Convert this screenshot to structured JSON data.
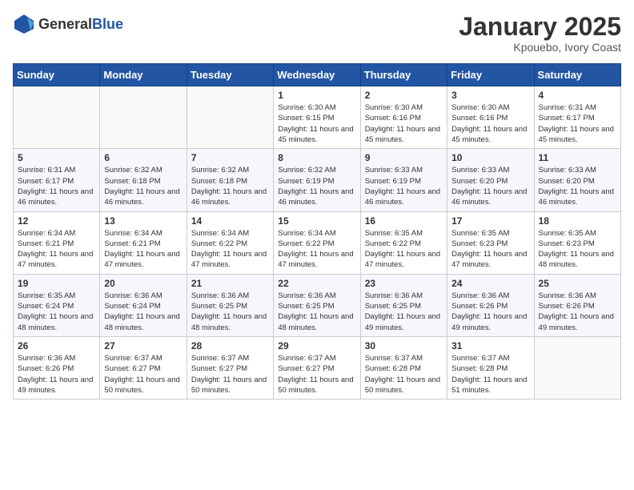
{
  "logo": {
    "general": "General",
    "blue": "Blue"
  },
  "header": {
    "month": "January 2025",
    "location": "Kpouebo, Ivory Coast"
  },
  "weekdays": [
    "Sunday",
    "Monday",
    "Tuesday",
    "Wednesday",
    "Thursday",
    "Friday",
    "Saturday"
  ],
  "weeks": [
    [
      {
        "day": "",
        "sunrise": "",
        "sunset": "",
        "daylight": ""
      },
      {
        "day": "",
        "sunrise": "",
        "sunset": "",
        "daylight": ""
      },
      {
        "day": "",
        "sunrise": "",
        "sunset": "",
        "daylight": ""
      },
      {
        "day": "1",
        "sunrise": "Sunrise: 6:30 AM",
        "sunset": "Sunset: 6:15 PM",
        "daylight": "Daylight: 11 hours and 45 minutes."
      },
      {
        "day": "2",
        "sunrise": "Sunrise: 6:30 AM",
        "sunset": "Sunset: 6:16 PM",
        "daylight": "Daylight: 11 hours and 45 minutes."
      },
      {
        "day": "3",
        "sunrise": "Sunrise: 6:30 AM",
        "sunset": "Sunset: 6:16 PM",
        "daylight": "Daylight: 11 hours and 45 minutes."
      },
      {
        "day": "4",
        "sunrise": "Sunrise: 6:31 AM",
        "sunset": "Sunset: 6:17 PM",
        "daylight": "Daylight: 11 hours and 45 minutes."
      }
    ],
    [
      {
        "day": "5",
        "sunrise": "Sunrise: 6:31 AM",
        "sunset": "Sunset: 6:17 PM",
        "daylight": "Daylight: 11 hours and 46 minutes."
      },
      {
        "day": "6",
        "sunrise": "Sunrise: 6:32 AM",
        "sunset": "Sunset: 6:18 PM",
        "daylight": "Daylight: 11 hours and 46 minutes."
      },
      {
        "day": "7",
        "sunrise": "Sunrise: 6:32 AM",
        "sunset": "Sunset: 6:18 PM",
        "daylight": "Daylight: 11 hours and 46 minutes."
      },
      {
        "day": "8",
        "sunrise": "Sunrise: 6:32 AM",
        "sunset": "Sunset: 6:19 PM",
        "daylight": "Daylight: 11 hours and 46 minutes."
      },
      {
        "day": "9",
        "sunrise": "Sunrise: 6:33 AM",
        "sunset": "Sunset: 6:19 PM",
        "daylight": "Daylight: 11 hours and 46 minutes."
      },
      {
        "day": "10",
        "sunrise": "Sunrise: 6:33 AM",
        "sunset": "Sunset: 6:20 PM",
        "daylight": "Daylight: 11 hours and 46 minutes."
      },
      {
        "day": "11",
        "sunrise": "Sunrise: 6:33 AM",
        "sunset": "Sunset: 6:20 PM",
        "daylight": "Daylight: 11 hours and 46 minutes."
      }
    ],
    [
      {
        "day": "12",
        "sunrise": "Sunrise: 6:34 AM",
        "sunset": "Sunset: 6:21 PM",
        "daylight": "Daylight: 11 hours and 47 minutes."
      },
      {
        "day": "13",
        "sunrise": "Sunrise: 6:34 AM",
        "sunset": "Sunset: 6:21 PM",
        "daylight": "Daylight: 11 hours and 47 minutes."
      },
      {
        "day": "14",
        "sunrise": "Sunrise: 6:34 AM",
        "sunset": "Sunset: 6:22 PM",
        "daylight": "Daylight: 11 hours and 47 minutes."
      },
      {
        "day": "15",
        "sunrise": "Sunrise: 6:34 AM",
        "sunset": "Sunset: 6:22 PM",
        "daylight": "Daylight: 11 hours and 47 minutes."
      },
      {
        "day": "16",
        "sunrise": "Sunrise: 6:35 AM",
        "sunset": "Sunset: 6:22 PM",
        "daylight": "Daylight: 11 hours and 47 minutes."
      },
      {
        "day": "17",
        "sunrise": "Sunrise: 6:35 AM",
        "sunset": "Sunset: 6:23 PM",
        "daylight": "Daylight: 11 hours and 47 minutes."
      },
      {
        "day": "18",
        "sunrise": "Sunrise: 6:35 AM",
        "sunset": "Sunset: 6:23 PM",
        "daylight": "Daylight: 11 hours and 48 minutes."
      }
    ],
    [
      {
        "day": "19",
        "sunrise": "Sunrise: 6:35 AM",
        "sunset": "Sunset: 6:24 PM",
        "daylight": "Daylight: 11 hours and 48 minutes."
      },
      {
        "day": "20",
        "sunrise": "Sunrise: 6:36 AM",
        "sunset": "Sunset: 6:24 PM",
        "daylight": "Daylight: 11 hours and 48 minutes."
      },
      {
        "day": "21",
        "sunrise": "Sunrise: 6:36 AM",
        "sunset": "Sunset: 6:25 PM",
        "daylight": "Daylight: 11 hours and 48 minutes."
      },
      {
        "day": "22",
        "sunrise": "Sunrise: 6:36 AM",
        "sunset": "Sunset: 6:25 PM",
        "daylight": "Daylight: 11 hours and 48 minutes."
      },
      {
        "day": "23",
        "sunrise": "Sunrise: 6:36 AM",
        "sunset": "Sunset: 6:25 PM",
        "daylight": "Daylight: 11 hours and 49 minutes."
      },
      {
        "day": "24",
        "sunrise": "Sunrise: 6:36 AM",
        "sunset": "Sunset: 6:26 PM",
        "daylight": "Daylight: 11 hours and 49 minutes."
      },
      {
        "day": "25",
        "sunrise": "Sunrise: 6:36 AM",
        "sunset": "Sunset: 6:26 PM",
        "daylight": "Daylight: 11 hours and 49 minutes."
      }
    ],
    [
      {
        "day": "26",
        "sunrise": "Sunrise: 6:36 AM",
        "sunset": "Sunset: 6:26 PM",
        "daylight": "Daylight: 11 hours and 49 minutes."
      },
      {
        "day": "27",
        "sunrise": "Sunrise: 6:37 AM",
        "sunset": "Sunset: 6:27 PM",
        "daylight": "Daylight: 11 hours and 50 minutes."
      },
      {
        "day": "28",
        "sunrise": "Sunrise: 6:37 AM",
        "sunset": "Sunset: 6:27 PM",
        "daylight": "Daylight: 11 hours and 50 minutes."
      },
      {
        "day": "29",
        "sunrise": "Sunrise: 6:37 AM",
        "sunset": "Sunset: 6:27 PM",
        "daylight": "Daylight: 11 hours and 50 minutes."
      },
      {
        "day": "30",
        "sunrise": "Sunrise: 6:37 AM",
        "sunset": "Sunset: 6:28 PM",
        "daylight": "Daylight: 11 hours and 50 minutes."
      },
      {
        "day": "31",
        "sunrise": "Sunrise: 6:37 AM",
        "sunset": "Sunset: 6:28 PM",
        "daylight": "Daylight: 11 hours and 51 minutes."
      },
      {
        "day": "",
        "sunrise": "",
        "sunset": "",
        "daylight": ""
      }
    ]
  ]
}
